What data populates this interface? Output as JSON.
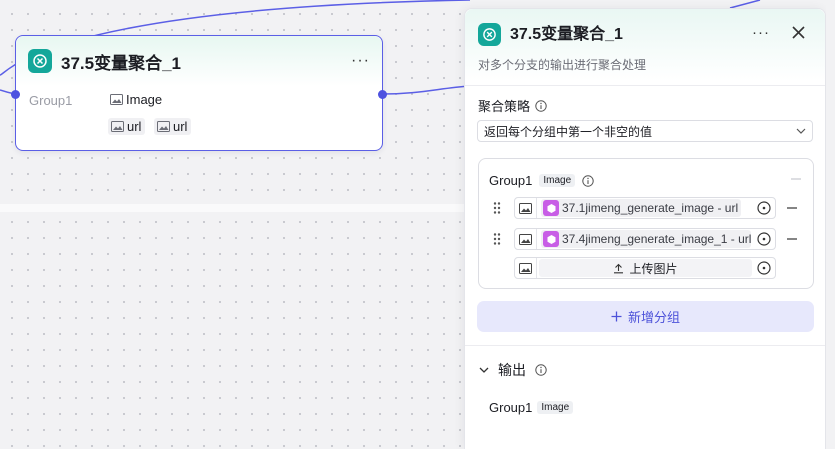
{
  "node": {
    "title": "37.5变量聚合_1",
    "more": "···",
    "group_label": "Group1",
    "vars": [
      "Image",
      "url",
      "url"
    ]
  },
  "panel": {
    "title": "37.5变量聚合_1",
    "more": "···",
    "description": "对多个分支的输出进行聚合处理",
    "strategy_label": "聚合策略",
    "strategy_value": "返回每个分组中第一个非空的值",
    "group": {
      "name": "Group1",
      "type": "Image",
      "rows": [
        {
          "ref": "37.1jimeng_generate_image - url"
        },
        {
          "ref": "37.4jimeng_generate_image_1 - url"
        }
      ],
      "upload_label": "上传图片"
    },
    "add_group_label": "新增分组",
    "output_label": "输出",
    "output": {
      "name": "Group1",
      "type": "Image"
    }
  },
  "colors": {
    "accent": "#4e52e0",
    "node_icon": "#14a79a",
    "ref_badge": "#c85ee6",
    "add_group_bg": "#e7e8fc"
  },
  "icons": [
    "variable-merge-icon",
    "image-icon",
    "info-icon",
    "chevron-down-icon",
    "close-icon",
    "drag-handle-icon",
    "target-icon",
    "minus-icon",
    "upload-icon",
    "plus-icon",
    "plugin-icon"
  ]
}
